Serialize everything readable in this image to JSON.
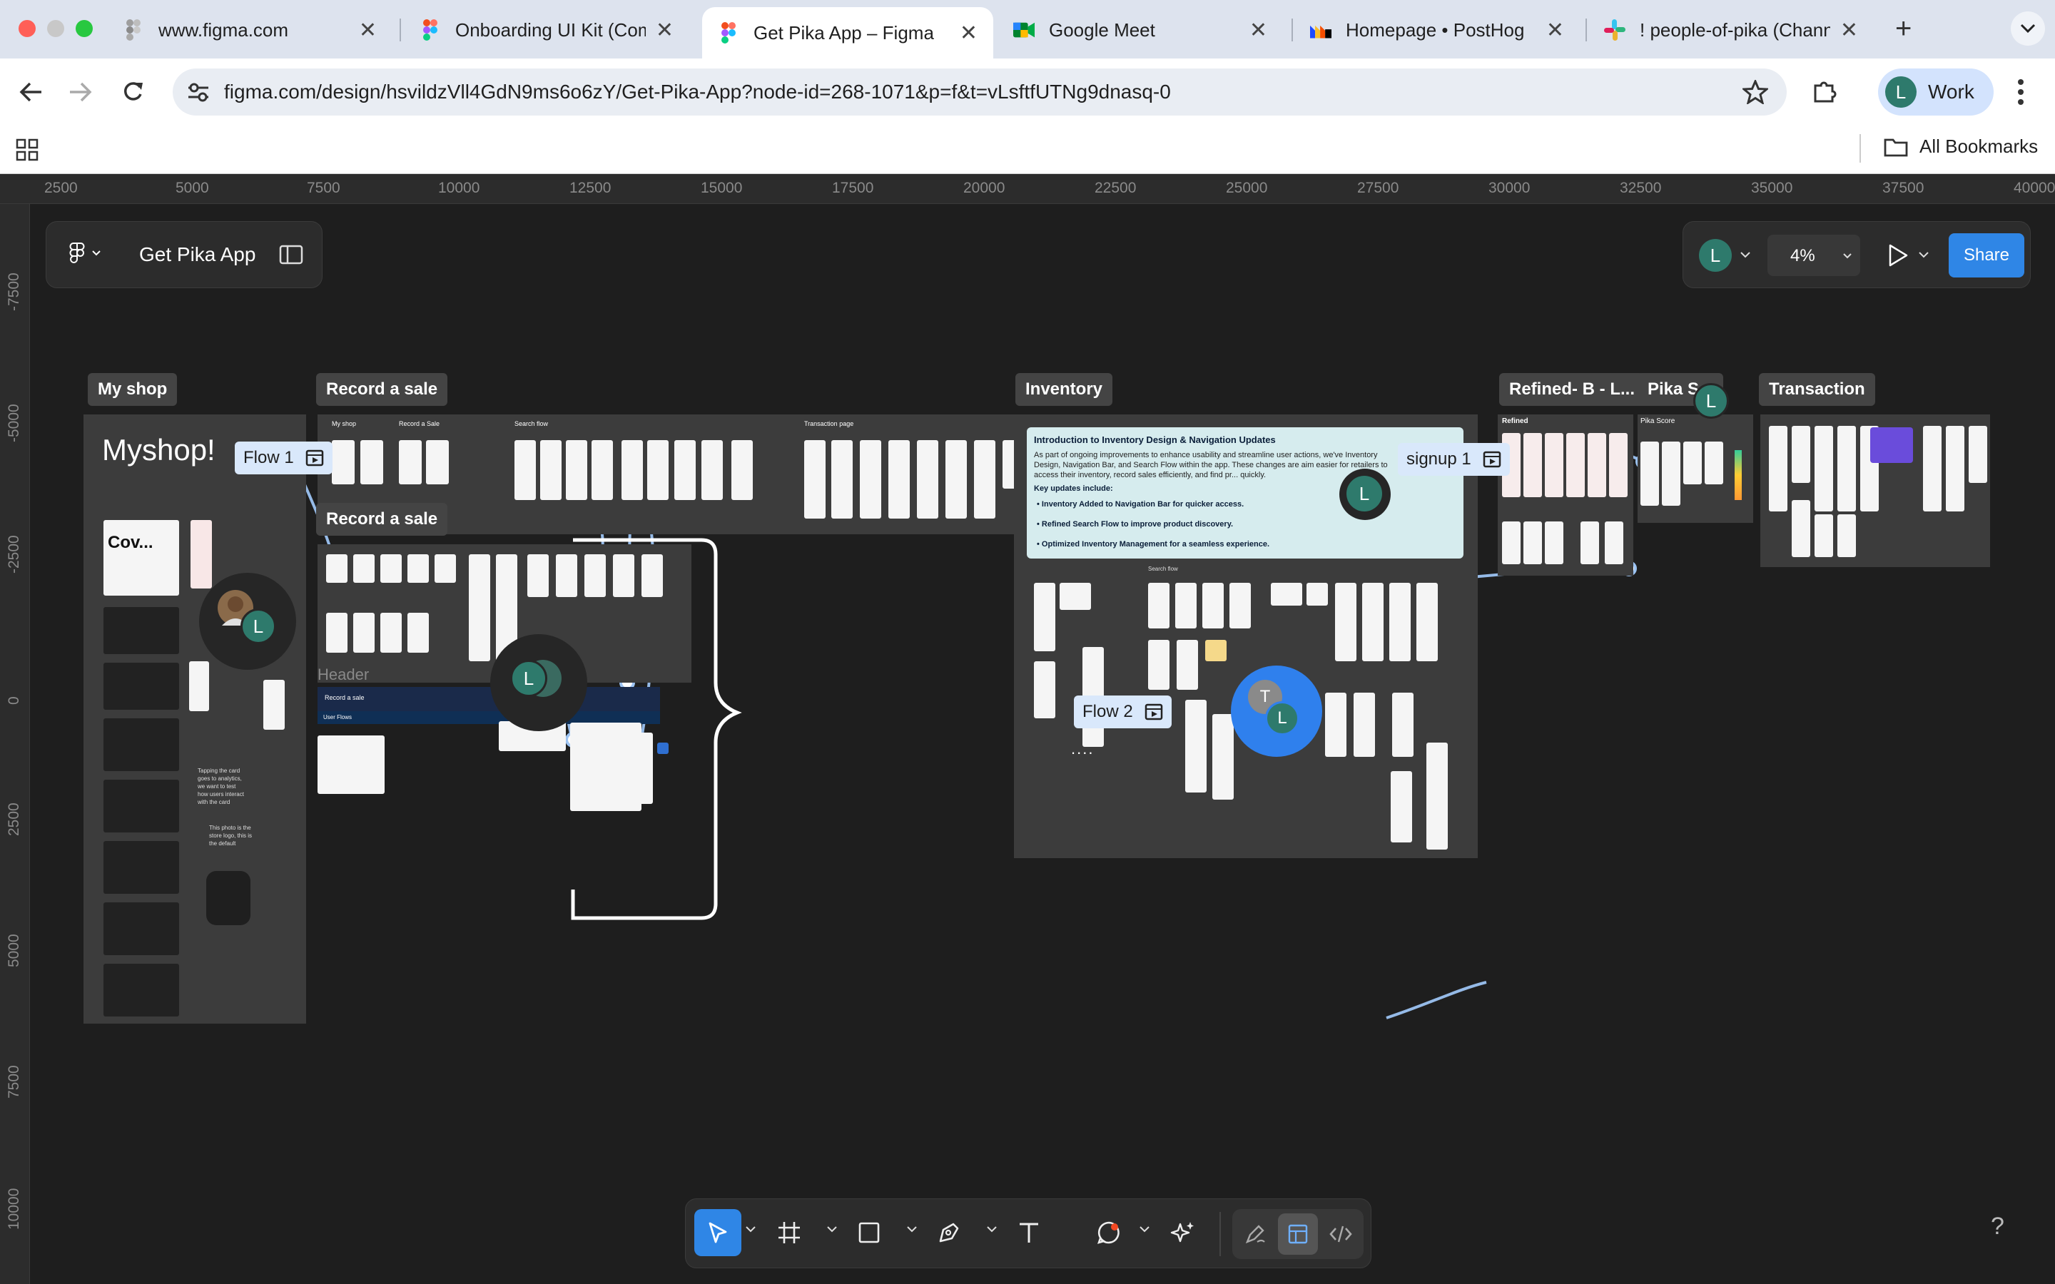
{
  "browser": {
    "tabs": [
      {
        "title": "www.figma.com",
        "favicon": "figma-gray-icon",
        "active": false
      },
      {
        "title": "Onboarding UI Kit (Comm",
        "favicon": "figma-icon",
        "active": false
      },
      {
        "title": "Get Pika App – Figma",
        "favicon": "figma-icon",
        "active": true
      },
      {
        "title": "Google Meet",
        "favicon": "google-meet-icon",
        "active": false
      },
      {
        "title": "Homepage • PostHog",
        "favicon": "posthog-icon",
        "active": false
      },
      {
        "title": "! people-of-pika (Chann",
        "favicon": "slack-icon",
        "active": false
      }
    ],
    "url": "figma.com/design/hsvildzVll4GdN9ms6o6zY/Get-Pika-App?node-id=268-1071&p=f&t=vLsftfUTNg9dnasq-0",
    "profile": {
      "initial": "L",
      "label": "Work"
    },
    "bookmarks_label": "All Bookmarks"
  },
  "figma": {
    "file_name": "Get Pika App",
    "zoom": "4%",
    "share_label": "Share",
    "user_initial": "L",
    "ruler_x": [
      "2500",
      "5000",
      "7500",
      "10000",
      "12500",
      "15000",
      "17500",
      "20000",
      "22500",
      "25000",
      "27500",
      "30000",
      "32500",
      "35000",
      "37500",
      "40000"
    ],
    "ruler_y": [
      "-7500",
      "-5000",
      "-2500",
      "0",
      "2500",
      "5000",
      "7500",
      "10000"
    ],
    "sections": [
      {
        "label": "My shop"
      },
      {
        "label": "Record a sale"
      },
      {
        "label": "Record a sale"
      },
      {
        "label": "Inventory"
      },
      {
        "label": "Refined- B - L..."
      },
      {
        "label": "Pika S..."
      },
      {
        "label": "Transaction"
      }
    ],
    "flows": [
      "Flow 1",
      "Flow 2",
      "signup 1"
    ],
    "myshop": {
      "title": "Myshop!",
      "cover": "Cov...",
      "note1": "Tapping the card goes to analytics, we want to test how users interact with the card",
      "note2": "This photo is the store logo, this is the default"
    },
    "header_label": "Header",
    "header_bar": "Record a sale",
    "user_flows": "User Flows",
    "minis": {
      "my_shop": "My shop",
      "record_sale": "Record a Sale",
      "search_flow": "Search flow",
      "transaction_page": "Transaction page",
      "inv_search_flow": "Search flow",
      "refined": "Refined",
      "pika_score": "Pika Score"
    },
    "inventory_card": {
      "title": "Introduction to Inventory Design & Navigation Updates",
      "intro": "As part of ongoing improvements to enhance usability and streamline user actions, we've Inventory Design, Navigation Bar, and Search Flow within the app. These changes are aim easier for retailers to access their inventory, record sales efficiently, and find pr... quickly.",
      "key_title": "Key updates include:",
      "bullets": [
        "Inventory Added to Navigation Bar for quicker access.",
        "Refined Search Flow to improve product discovery.",
        "Optimized Inventory Management for a seamless experience."
      ]
    },
    "collaborators": [
      "L",
      "L",
      "L",
      "T",
      "L",
      "L"
    ],
    "ellipsis": "....",
    "help": "?"
  }
}
